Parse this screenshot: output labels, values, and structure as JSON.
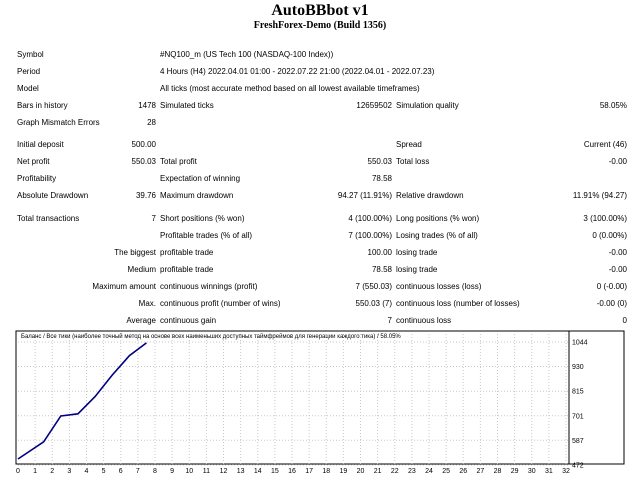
{
  "header": {
    "title": "AutoBBbot v1",
    "subtitle": "FreshForex-Demo (Build 1356)"
  },
  "info": {
    "symbol_label": "Symbol",
    "symbol_value": "#NQ100_m (US Tech 100 (NASDAQ-100 Index))",
    "period_label": "Period",
    "period_value": "4 Hours (H4) 2022.04.01 01:00 - 2022.07.22 21:00 (2022.04.01 - 2022.07.23)",
    "model_label": "Model",
    "model_value": "All ticks (most accurate method based on all lowest available timeframes)",
    "bars_label": "Bars in history",
    "bars_value": "1478",
    "ticks_label": "Simulated ticks",
    "ticks_value": "12659502",
    "quality_label": "Simulation quality",
    "quality_value": "58.05%",
    "mismatch_label": "Graph Mismatch Errors",
    "mismatch_value": "28"
  },
  "stats": {
    "initial_deposit_label": "Initial deposit",
    "initial_deposit_value": "500.00",
    "spread_label": "Spread",
    "spread_value": "Current (46)",
    "net_profit_label": "Net profit",
    "net_profit_value": "550.03",
    "total_profit_label": "Total profit",
    "total_profit_value": "550.03",
    "total_loss_label": "Total loss",
    "total_loss_value": "-0.00",
    "profitability_label": "Profitability",
    "expectation_label": "Expectation of winning",
    "expectation_value": "78.58",
    "abs_drawdown_label": "Absolute Drawdown",
    "abs_drawdown_value": "39.76",
    "max_drawdown_label": "Maximum drawdown",
    "max_drawdown_value": "94.27 (11.91%)",
    "rel_drawdown_label": "Relative drawdown",
    "rel_drawdown_value": "11.91% (94.27)",
    "total_tx_label": "Total transactions",
    "total_tx_value": "7",
    "short_label": "Short positions (% won)",
    "short_value": "4 (100.00%)",
    "long_label": "Long positions (% won)",
    "long_value": "3 (100.00%)",
    "profitable_label": "Profitable trades (% of all)",
    "profitable_value": "7 (100.00%)",
    "losing_label": "Losing trades (% of all)",
    "losing_value": "0 (0.00%)",
    "biggest_label": "The biggest",
    "biggest_profit_label": "profitable trade",
    "biggest_profit_value": "100.00",
    "biggest_loss_label": "losing trade",
    "biggest_loss_value": "-0.00",
    "medium_label": "Medium",
    "medium_profit_label": "profitable trade",
    "medium_profit_value": "78.58",
    "medium_loss_label": "losing trade",
    "medium_loss_value": "-0.00",
    "max_amount_label": "Maximum amount",
    "max_wins_label": "continuous winnings (profit)",
    "max_wins_value": "7 (550.03)",
    "max_losses_label": "continuous losses (loss)",
    "max_losses_value": "0 (-0.00)",
    "max_label": "Max.",
    "max_profit_label": "continuous profit (number of wins)",
    "max_profit_value": "550.03 (7)",
    "max_loss_label": "continuous loss (number of losses)",
    "max_loss_value": "-0.00 (0)",
    "average_label": "Average",
    "avg_gain_label": "continuous gain",
    "avg_gain_value": "7",
    "avg_loss_label": "continuous loss",
    "avg_loss_value": "0"
  },
  "chart_data": {
    "type": "line",
    "title": "Баланс / Все тики (наиболее точный метод на основе всех наименьших доступных таймфреймов для генерации каждого тика) / 58.05%",
    "xlabel": "",
    "ylabel": "",
    "x_ticks": [
      "0",
      "1",
      "2",
      "3",
      "4",
      "5",
      "6",
      "7",
      "8",
      "9",
      "10",
      "11",
      "12",
      "13",
      "14",
      "15",
      "16",
      "17",
      "18",
      "19",
      "20",
      "21",
      "22",
      "23",
      "24",
      "25",
      "26",
      "27",
      "28",
      "29",
      "30",
      "31",
      "32"
    ],
    "y_ticks": [
      "1044",
      "930",
      "815",
      "701",
      "587",
      "472"
    ],
    "xlim": [
      0,
      32
    ],
    "ylim": [
      472,
      1044
    ],
    "grid": true,
    "line_color": "#000080",
    "series": [
      {
        "x": [
          0,
          1.5,
          2.5,
          3.5,
          4.5,
          5.5,
          6.5,
          7.5
        ],
        "y": [
          500,
          580,
          700,
          710,
          790,
          890,
          980,
          1040
        ]
      }
    ]
  }
}
